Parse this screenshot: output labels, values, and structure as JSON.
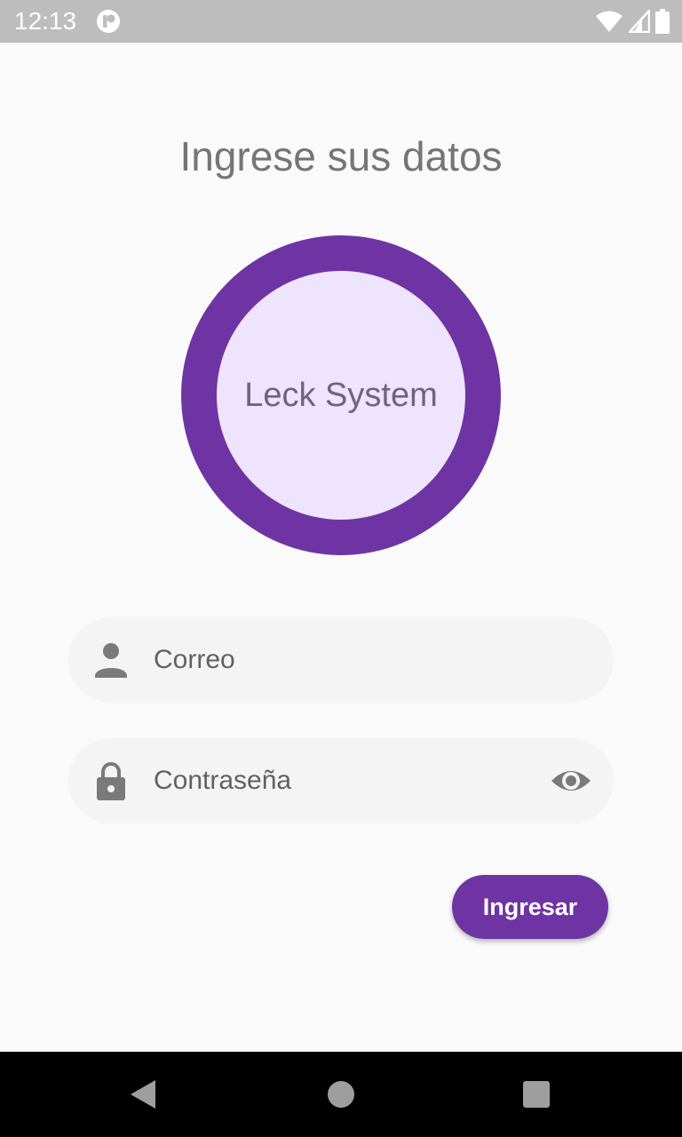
{
  "status_bar": {
    "time": "12:13",
    "app_icon": "app-notification-icon",
    "icons": [
      "wifi-icon",
      "signal-icon",
      "battery-icon"
    ]
  },
  "page": {
    "heading": "Ingrese sus datos"
  },
  "logo": {
    "text": "Leck System"
  },
  "form": {
    "email": {
      "placeholder": "Correo",
      "value": "",
      "icon": "person-icon"
    },
    "password": {
      "placeholder": "Contraseña",
      "value": "",
      "icon": "lock-icon",
      "toggle_icon": "eye-icon"
    },
    "submit_label": "Ingresar"
  },
  "nav_bar": {
    "buttons": [
      "back-icon",
      "home-icon",
      "recents-icon"
    ]
  },
  "colors": {
    "primary": "#6f34a4",
    "logo_inner": "#efe4fd",
    "background": "#fafafa",
    "field_background": "#f4f4f4",
    "status_bar": "#bdbdbd"
  }
}
